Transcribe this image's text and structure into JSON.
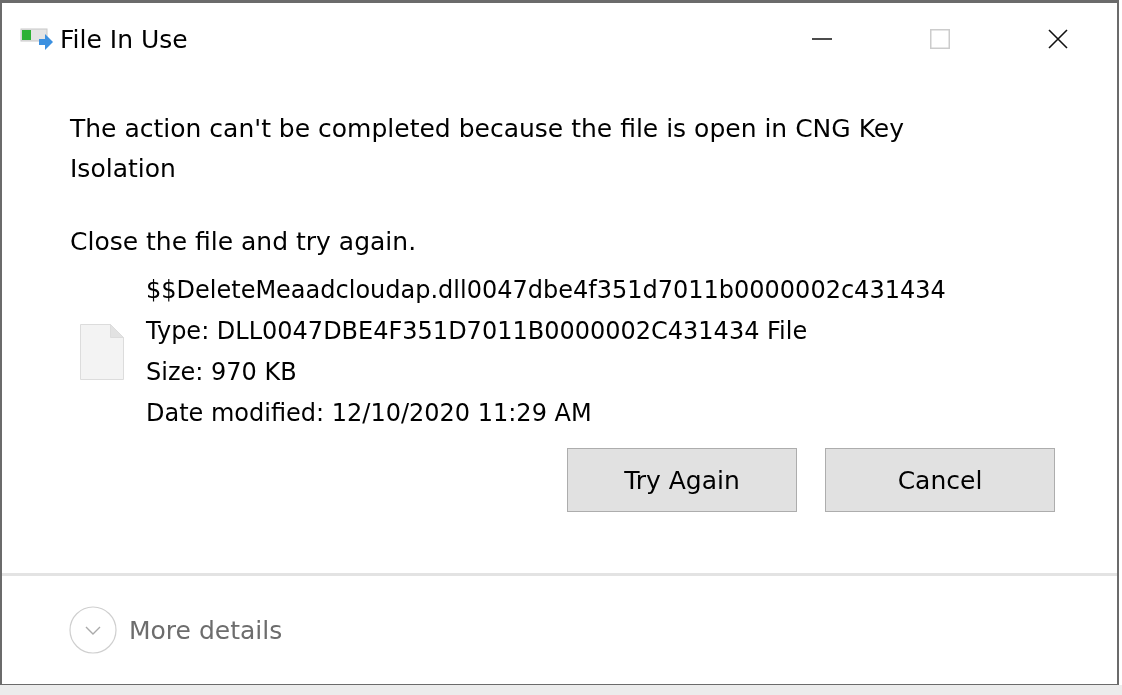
{
  "window": {
    "title": "File In Use",
    "maximize_disabled": true
  },
  "message": "The action can't be completed because the file is open in CNG Key Isolation",
  "instruction": "Close the file and try again.",
  "file": {
    "name": "$$DeleteMeaadcloudap.dll0047dbe4f351d7011b0000002c431434",
    "type": "Type: DLL0047DBE4F351D7011B0000002C431434 File",
    "size": "Size: 970 KB",
    "date": "Date modified: 12/10/2020 11:29 AM"
  },
  "buttons": [
    "Try Again",
    "Cancel"
  ],
  "footer": {
    "label": "More details",
    "expanded": false
  }
}
